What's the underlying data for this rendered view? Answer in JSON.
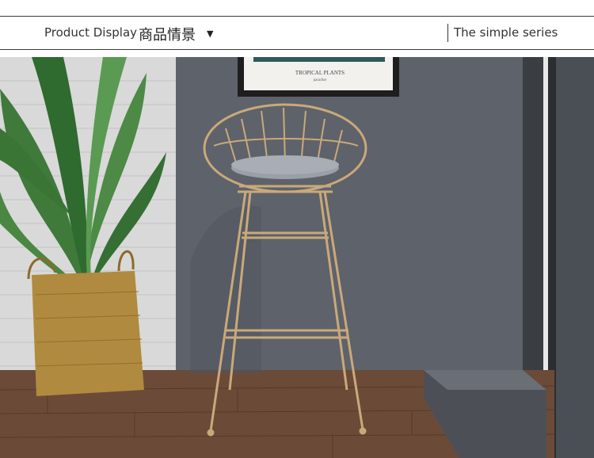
{
  "header": {
    "title_en": "Product Display",
    "title_cn": "商品情景",
    "caret": "▼",
    "series": "The simple series"
  },
  "photo": {
    "poster_title": "TROPICAL PLANTS",
    "poster_subtitle": "paradise",
    "icons": [
      "potted-plant",
      "gold-wire-bar-stool",
      "framed-poster"
    ],
    "colors": {
      "wall": "#5b5f66",
      "floor": "#6b4b38",
      "gold": "#c9a97a",
      "cushion": "#9aa0a8",
      "basket": "#b08a3e"
    }
  }
}
